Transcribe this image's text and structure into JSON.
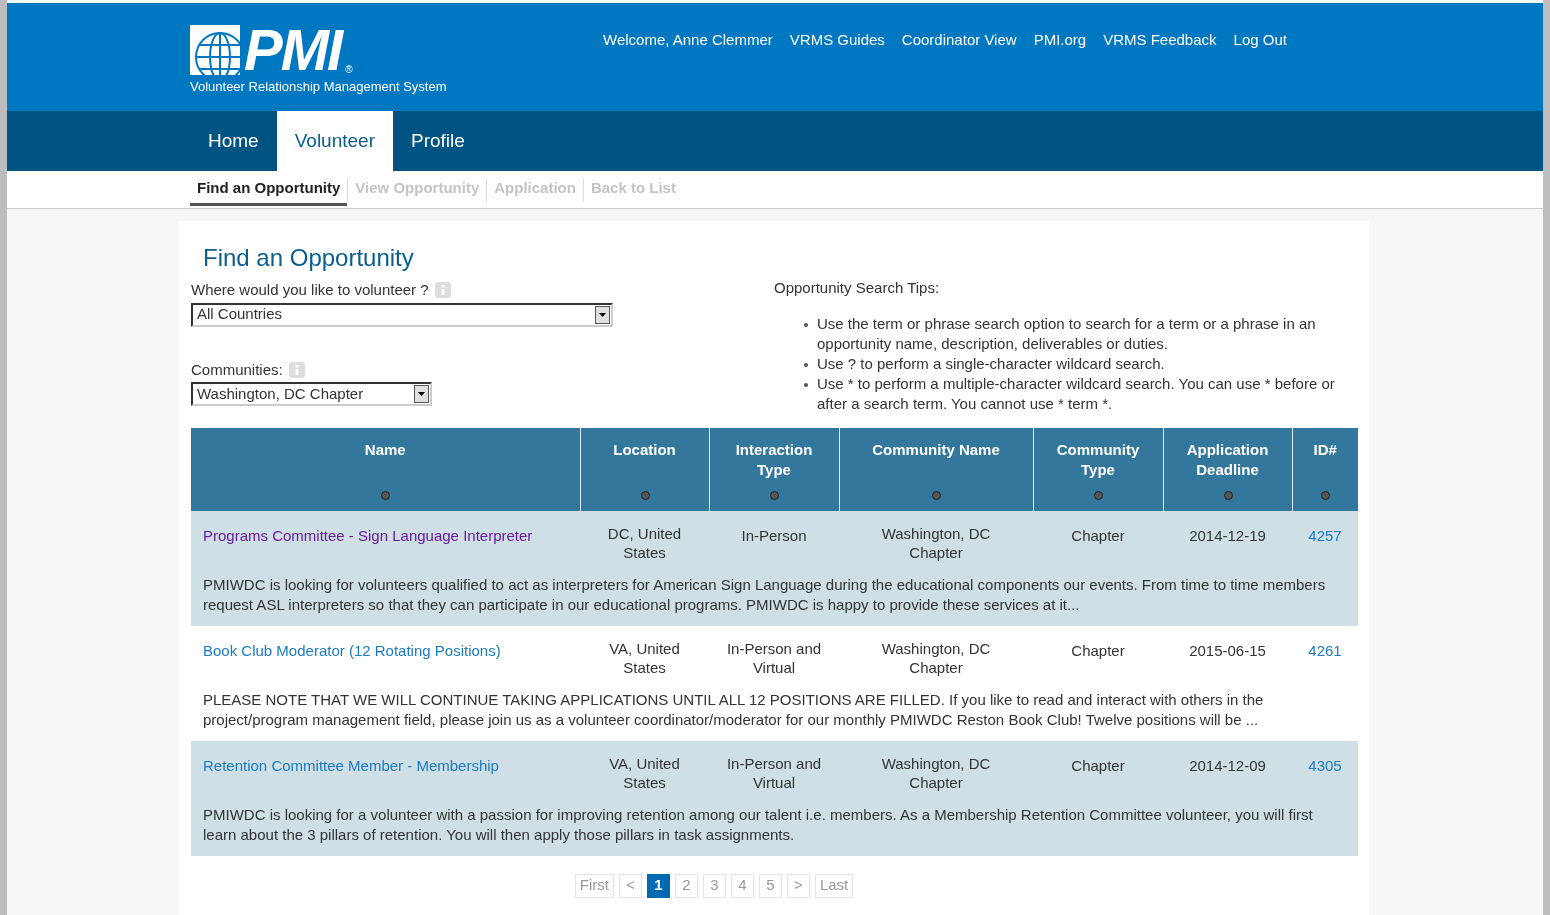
{
  "header": {
    "logo_text": "PMI",
    "logo_mark": "®",
    "subtitle": "Volunteer Relationship Management System",
    "links": [
      "Welcome, Anne Clemmer",
      "VRMS Guides",
      "Coordinator View",
      "PMI.org",
      "VRMS Feedback",
      "Log Out"
    ]
  },
  "nav": [
    {
      "label": "Home",
      "selected": false
    },
    {
      "label": "Volunteer",
      "selected": true
    },
    {
      "label": "Profile",
      "selected": false
    }
  ],
  "subnav": [
    {
      "label": "Find an Opportunity",
      "selected": true
    },
    {
      "label": "View Opportunity",
      "selected": false
    },
    {
      "label": "Application",
      "selected": false
    },
    {
      "label": "Back to List",
      "selected": false
    }
  ],
  "page_title": "Find an Opportunity",
  "filters": [
    {
      "label": "Where would you like to volunteer ?",
      "value": "All Countries"
    },
    {
      "label": "Communities:",
      "value": "Washington, DC Chapter"
    }
  ],
  "tips": {
    "title": "Opportunity Search Tips:",
    "items": [
      "Use the term or phrase search option to search for a term or a phrase in an opportunity name, description, deliverables or duties.",
      "Use ? to perform a single-character wildcard search.",
      "Use * to perform a multiple-character wildcard search. You can use * before or after a search term. You cannot use * term *."
    ]
  },
  "table": {
    "columns": [
      "Name",
      "Location",
      "Interaction Type",
      "Community Name",
      "Community Type",
      "Application Deadline",
      "ID#"
    ],
    "rows": [
      {
        "name": "Programs Committee - Sign Language Interpreter",
        "visited": true,
        "location": "DC, United States",
        "interaction": "In-Person",
        "community": "Washington, DC Chapter",
        "community_type": "Chapter",
        "deadline": "2014-12-19",
        "id": "4257",
        "description": "PMIWDC is looking for volunteers qualified to act as interpreters for American Sign Language during the educational components our events. From time to time members request ASL interpreters so that they can participate in our educational programs. PMIWDC is happy to provide these services at it..."
      },
      {
        "name": "Book Club Moderator (12 Rotating Positions)",
        "visited": false,
        "location": "VA, United States",
        "interaction": "In-Person and Virtual",
        "community": "Washington, DC Chapter",
        "community_type": "Chapter",
        "deadline": "2015-06-15",
        "id": "4261",
        "description": "PLEASE NOTE THAT WE WILL CONTINUE TAKING APPLICATIONS UNTIL ALL 12 POSITIONS ARE FILLED. If you like to read and interact with others in the project/program management field, please join us as a volunteer coordinator/moderator for our monthly PMIWDC Reston Book Club! Twelve positions will be ..."
      },
      {
        "name": "Retention Committee Member - Membership",
        "visited": false,
        "location": "VA, United States",
        "interaction": "In-Person and Virtual",
        "community": "Washington, DC Chapter",
        "community_type": "Chapter",
        "deadline": "2014-12-09",
        "id": "4305",
        "description": "PMIWDC is looking for a volunteer with a passion for improving retention among our talent i.e. members. As a Membership Retention Committee volunteer, you will first learn about the 3 pillars of retention. You will then apply those pillars in task assignments."
      }
    ]
  },
  "pagination": [
    {
      "label": "First",
      "selected": false
    },
    {
      "label": "<",
      "selected": false
    },
    {
      "label": "1",
      "selected": true
    },
    {
      "label": "2",
      "selected": false
    },
    {
      "label": "3",
      "selected": false
    },
    {
      "label": "4",
      "selected": false
    },
    {
      "label": "5",
      "selected": false
    },
    {
      "label": ">",
      "selected": false
    },
    {
      "label": "Last",
      "selected": false
    }
  ]
}
